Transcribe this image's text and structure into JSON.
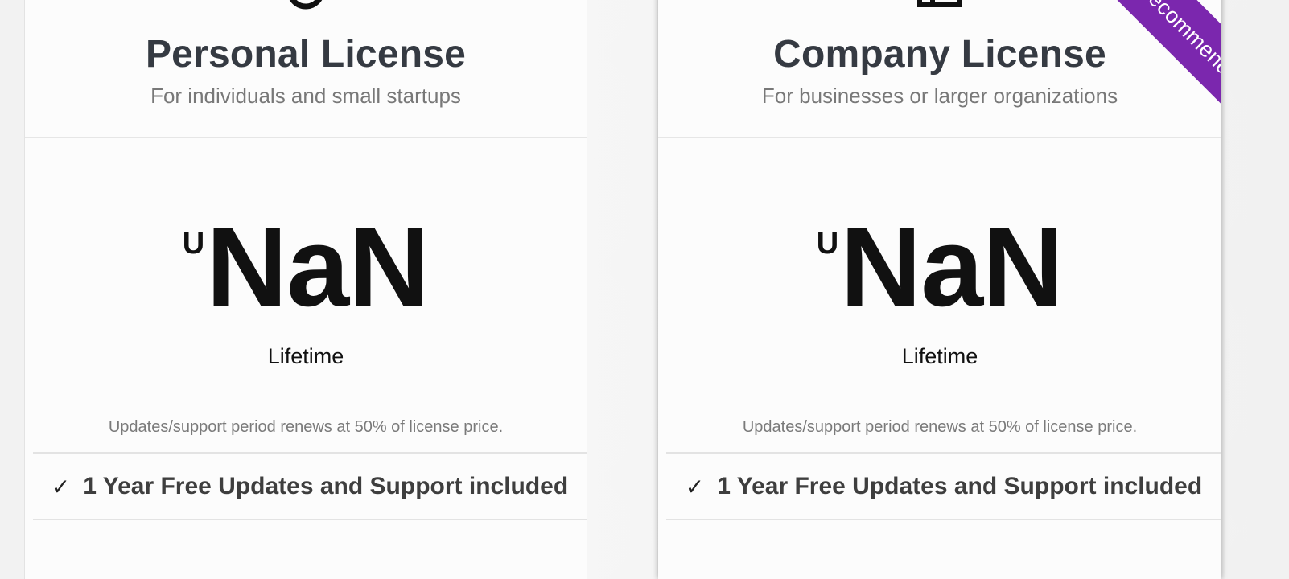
{
  "cards": [
    {
      "icon": "person-icon",
      "title": "Personal License",
      "subtitle": "For individuals and small startups",
      "currency": "U",
      "price": "NaN",
      "period": "Lifetime",
      "renew_note": "Updates/support period renews at 50% of license price.",
      "feature": "1 Year Free Updates and Support included"
    },
    {
      "icon": "building-icon",
      "title": "Company License",
      "subtitle": "For businesses or larger organizations",
      "currency": "U",
      "price": "NaN",
      "period": "Lifetime",
      "renew_note": "Updates/support period renews at 50% of license price.",
      "feature": "1 Year Free Updates and Support included",
      "ribbon": "Recommended",
      "ribbon_color": "#7b27ae"
    }
  ],
  "check_glyph": "✓"
}
